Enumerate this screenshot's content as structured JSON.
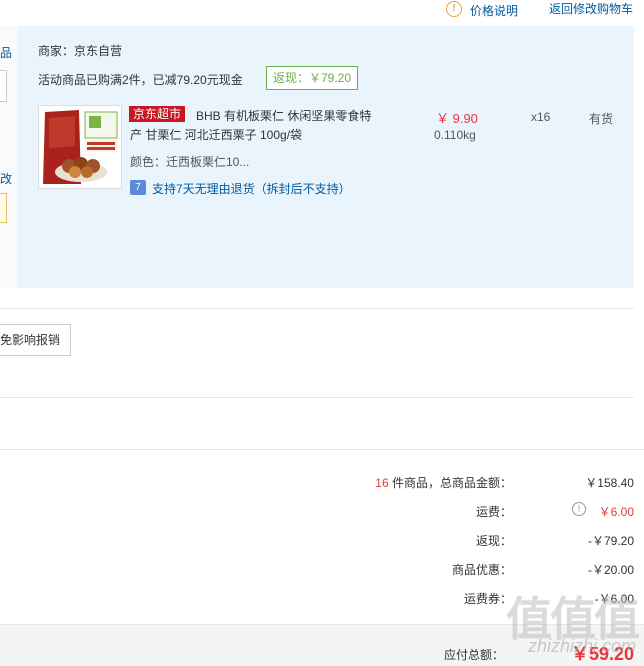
{
  "header": {
    "price_info_label": "价格说明",
    "back_to_cart_label": "返回修改购物车"
  },
  "left_edge": {
    "label_top": "品",
    "label_mid": "改"
  },
  "shop": {
    "merchant_label": "商家：京东自营",
    "promo_text": "活动商品已购满2件，已减79.20元现金",
    "rebate_text": "返现：￥79.20"
  },
  "item": {
    "badge": "京东超市",
    "title_line1": "BHB 有机板栗仁 休闲坚果零食特",
    "title_line2": "产 甘栗仁 河北迁西栗子 100g/袋",
    "variant": "颜色：迁西板栗仁10...",
    "service_text": "支持7天无理由退货（拆封后不支持）",
    "price": "￥ 9.90",
    "weight": "0.110kg",
    "quantity": "x16",
    "stock": "有货"
  },
  "invoice_button_label": "免影响报销",
  "summary": {
    "count": "16",
    "count_suffix": "件商品，总商品金额：",
    "total_goods": "￥158.40",
    "shipping_label": "运费：",
    "shipping_value": "￥6.00",
    "rebate_label": "返现：",
    "rebate_value": "-￥79.20",
    "discount_label": "商品优惠：",
    "discount_value": "-￥20.00",
    "coupon_label": "运费券：",
    "coupon_value": "-￥6.00"
  },
  "footer": {
    "payable_label": "应付总额：",
    "payable_value": "￥59.20"
  },
  "watermark": {
    "logo_text": "值值值",
    "url_text": "zhizhizhi.com"
  },
  "colors": {
    "accent_red": "#e4393c",
    "link_blue": "#005aa0",
    "rebate_green": "#6ab04c",
    "panel_blue": "#eaf4fc"
  }
}
